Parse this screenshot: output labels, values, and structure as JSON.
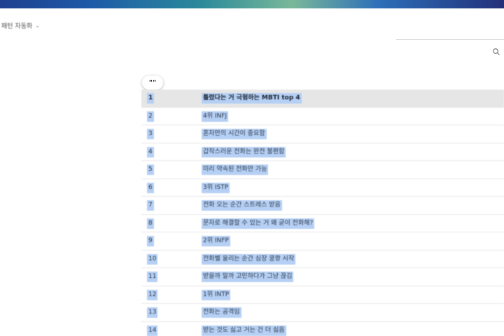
{
  "header": {
    "left_text": "패턴 자동화",
    "dropdown_caret": "⌄"
  },
  "table": {
    "header_button": "\"\"",
    "rows": [
      {
        "num": "1",
        "text": "틀렸다는 거 극혐하는 MBTI top 4"
      },
      {
        "num": "2",
        "text": "4위 INFJ"
      },
      {
        "num": "3",
        "text": "혼자만의 시간이 중요함"
      },
      {
        "num": "4",
        "text": "갑작스러운 전화는 완전 불편함"
      },
      {
        "num": "5",
        "text": "미리 약속된 전화만 가능"
      },
      {
        "num": "6",
        "text": "3위 ISTP"
      },
      {
        "num": "7",
        "text": "전화 오는 순간 스트레스 받음"
      },
      {
        "num": "8",
        "text": "문자로 해결할 수 있는 거 왜 굳이 전화해?"
      },
      {
        "num": "9",
        "text": "2위 INFP"
      },
      {
        "num": "10",
        "text": "전화벨 울리는 순간 심장 쿵쾅 시작"
      },
      {
        "num": "11",
        "text": "받을까 말까 고민하다가 그냥 끊김"
      },
      {
        "num": "12",
        "text": "1위 INTP"
      },
      {
        "num": "13",
        "text": "전화는 공격임"
      },
      {
        "num": "14",
        "text": "받는 것도 싫고 거는 건 더 싫음"
      }
    ]
  },
  "colors": {
    "selection_highlight": "#b5d0f4",
    "selected_row": "#e6e6e6"
  },
  "icons": {
    "search": "search-icon",
    "caret": "chevron-down-icon"
  }
}
